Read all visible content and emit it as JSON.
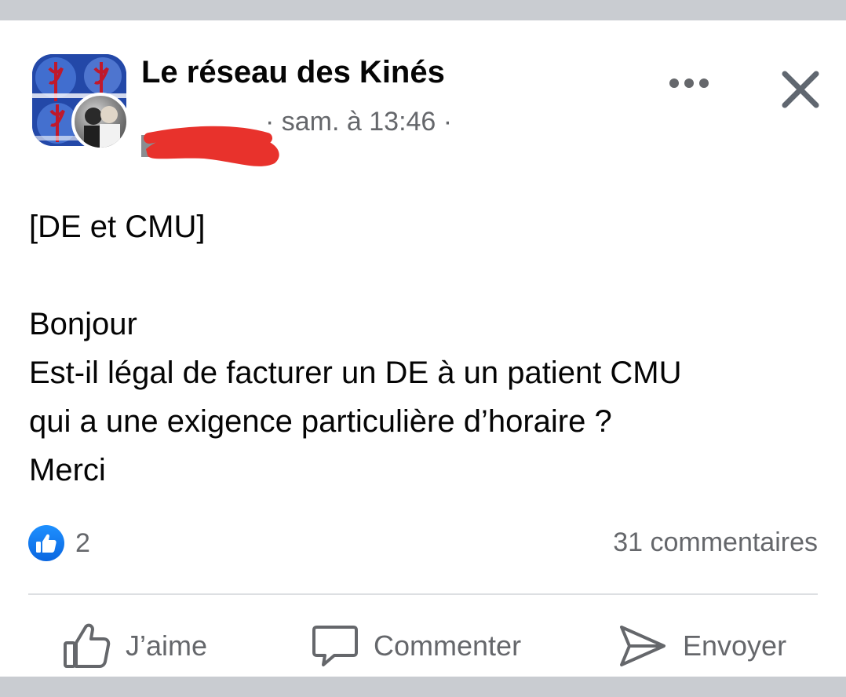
{
  "post": {
    "group_name": "Le réseau des Kinés",
    "author_redacted": "",
    "timestamp": "· sam. à 13:46 ·",
    "body": {
      "line1": "[DE et CMU]",
      "line2": "Bonjour",
      "line3": "Est-il légal de facturer un DE à un patient CMU",
      "line4": "qui a une exigence particulière d’horaire ?",
      "line5": "Merci"
    },
    "reactions": {
      "icon": "thumbs-up-icon",
      "count": "2",
      "accent": "#1877f2"
    },
    "comments_label": "31 commentaires"
  },
  "actions": {
    "like_label": "J’aime",
    "comment_label": "Commenter",
    "send_label": "Envoyer"
  },
  "colors": {
    "text_primary": "#050505",
    "text_secondary": "#65676b",
    "redaction": "#e8322c",
    "background": "#c9ccd1"
  }
}
